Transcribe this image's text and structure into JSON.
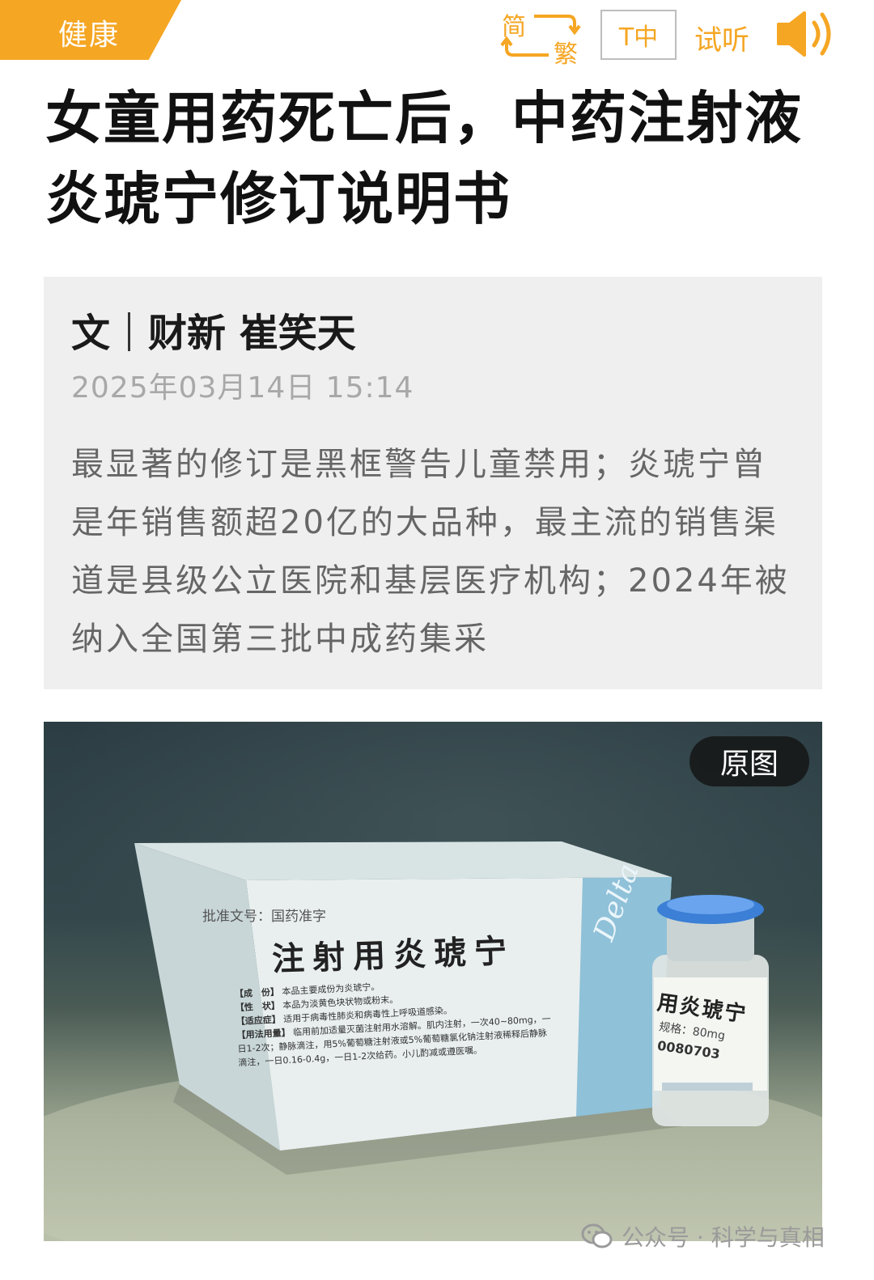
{
  "header": {
    "category": "健康",
    "convert": {
      "simplified": "简",
      "traditional": "繁"
    },
    "font_size_label": "T中",
    "listen_label": "试听"
  },
  "article": {
    "headline_line1": "女童用药死亡后，中药注射液",
    "headline_line2": "炎琥宁修订说明书",
    "byline_prefix": "文",
    "byline_author": "财新 崔笑天",
    "date": "2025年03月14日 15:14",
    "summary": "最显著的修订是黑框警告儿童禁用；炎琥宁曾是年销售额超20亿的大品种，最主流的销售渠道是县级公立医院和基层医疗机构；2024年被纳入全国第三批中成药集采"
  },
  "image": {
    "original_button": "原图",
    "box_approval": "批准文号：国药准字",
    "box_title": "注射用炎琥宁",
    "box_rows": [
      {
        "label": "【成　份】",
        "text": "本品主要成份为炎琥宁。"
      },
      {
        "label": "【性　状】",
        "text": "本品为淡黄色块状物或粉末。"
      },
      {
        "label": "【适应症】",
        "text": "适用于病毒性肺炎和病毒性上呼吸道感染。"
      },
      {
        "label": "【用法用量】",
        "text": "临用前加适量灭菌注射用水溶解。肌内注射，一次40~80mg，一日1-2次；静脉滴注，用5%葡萄糖注射液或5%葡萄糖氯化钠注射液稀释后静脉滴注，一日0.16-0.4g，一日1-2次给药。小儿酌减或遵医嘱。"
      }
    ],
    "box_brand": "Delta",
    "vial_title": "用炎琥宁",
    "vial_spec": "规格：80mg",
    "vial_code": "0080703"
  },
  "footer": {
    "watermark": "公众号 · 科学与真相"
  },
  "colors": {
    "accent": "#f5a623",
    "box_bg": "#efefef"
  }
}
